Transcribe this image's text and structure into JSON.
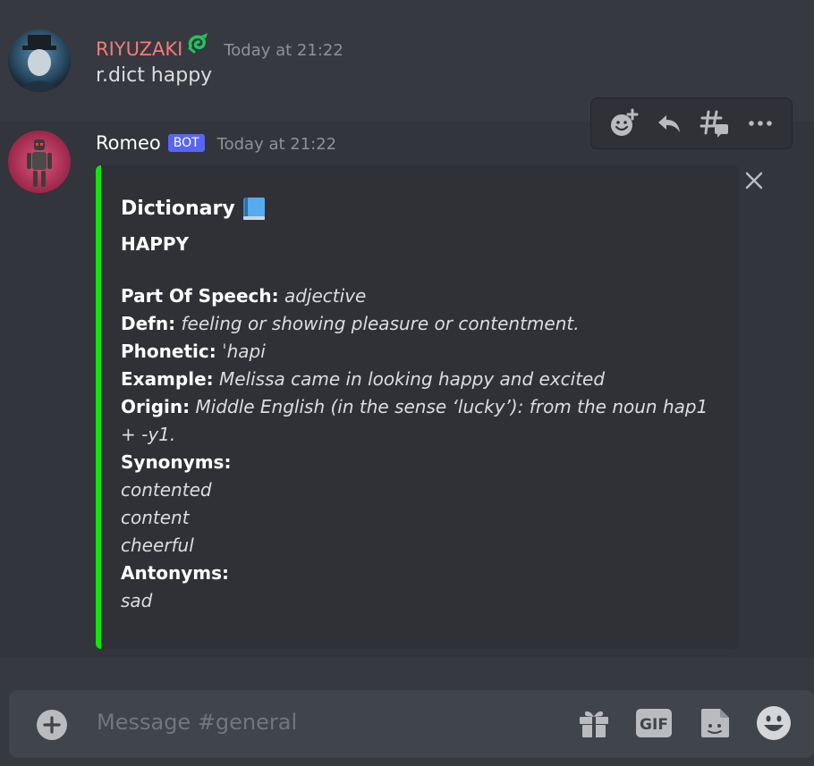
{
  "messages": [
    {
      "username": "RIYUZAKI",
      "username_color": "#f47b7b",
      "badge_icon": "green-dragon-icon",
      "timestamp": "Today at 21:22",
      "content": "r.dict happy"
    },
    {
      "username": "Romeo",
      "bot_badge": "BOT",
      "timestamp": "Today at 21:22",
      "embed": {
        "accent_color": "#13e40b",
        "title": "Dictionary",
        "title_icon": "blue-book-icon",
        "word": "HAPPY",
        "fields": [
          {
            "label": "Part Of Speech:",
            "value": "adjective"
          },
          {
            "label": "Defn:",
            "value": "feeling or showing pleasure or contentment."
          },
          {
            "label": "Phonetic:",
            "value": "ˈhapi"
          },
          {
            "label": "Example:",
            "value": "Melissa came in looking happy and excited"
          },
          {
            "label": "Origin:",
            "value": "Middle English (in the sense ‘lucky’): from the noun hap1",
            "value_cont": "+ -y1."
          }
        ],
        "synonyms_label": "Synonyms:",
        "synonyms": [
          "contented",
          "content",
          "cheerful"
        ],
        "antonyms_label": "Antonyms:",
        "antonyms": [
          "sad"
        ]
      }
    }
  ],
  "toolbar": {
    "icons": [
      "add-reaction-icon",
      "reply-icon",
      "create-thread-icon",
      "more-icon"
    ]
  },
  "input": {
    "placeholder": "Message #general",
    "icons": [
      "add-attachment-icon",
      "gift-icon",
      "gif-icon",
      "sticker-icon",
      "emoji-icon"
    ],
    "gif_label": "GIF"
  },
  "colors": {
    "background": "#36393f",
    "embed_background": "#2f3136",
    "bot_badge": "#5865f2"
  }
}
